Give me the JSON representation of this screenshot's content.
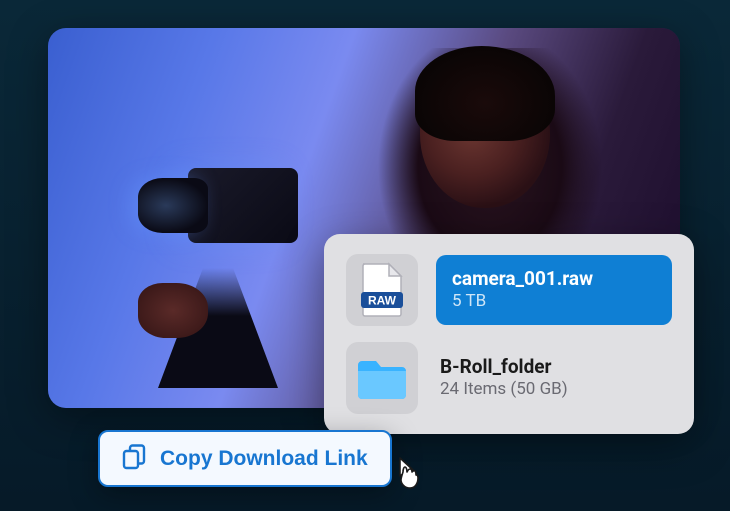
{
  "files": [
    {
      "name": "camera_001.raw",
      "meta": "5 TB",
      "icon_badge": "RAW",
      "selected": true
    },
    {
      "name": "B-Roll_folder",
      "meta": "24 Items (50 GB)",
      "selected": false
    }
  ],
  "action_button": {
    "label": "Copy Download Link"
  },
  "colors": {
    "accent": "#1876d1",
    "selected_bg": "#0f7fd4",
    "folder_fill": "#39b3ff"
  }
}
